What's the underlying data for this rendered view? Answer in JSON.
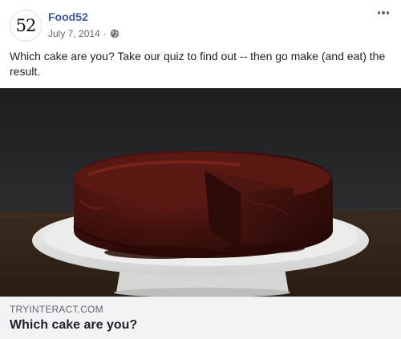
{
  "post": {
    "page_name": "Food52",
    "avatar_text": "52",
    "date": "July 7, 2014",
    "separator": "·",
    "privacy_icon": "globe-icon",
    "more_icon": "more-options-icon",
    "text": "Which cake are you? Take our quiz to find out -- then go make (and eat) the result.",
    "link": {
      "domain": "TRYINTERACT.COM",
      "title": "Which cake are you?"
    }
  },
  "colors": {
    "page_name": "#385898",
    "meta_text": "#616770",
    "link_box_bg": "#f2f3f5",
    "cake_dark": "#3a0f0c",
    "plate": "#e8e8e8"
  }
}
